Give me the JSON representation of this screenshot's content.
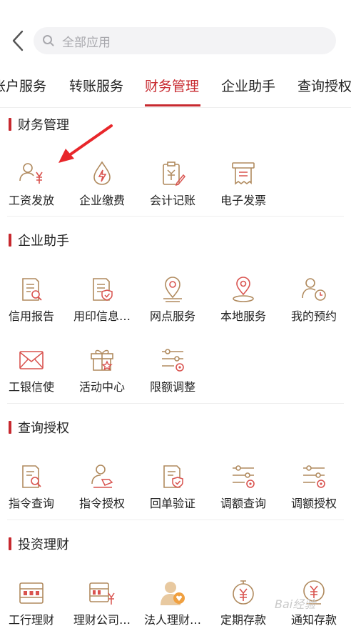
{
  "search": {
    "placeholder": "全部应用"
  },
  "tabs": [
    "账户服务",
    "转账服务",
    "财务管理",
    "企业助手",
    "查询授权"
  ],
  "sections": [
    {
      "title": "财务管理",
      "items": [
        {
          "label": "工资发放",
          "icon": "salary-yuan-icon"
        },
        {
          "label": "企业缴费",
          "icon": "payment-drop-icon"
        },
        {
          "label": "会计记账",
          "icon": "accounting-icon"
        },
        {
          "label": "电子发票",
          "icon": "invoice-icon"
        }
      ]
    },
    {
      "title": "企业助手",
      "items": [
        {
          "label": "信用报告",
          "icon": "credit-report-icon"
        },
        {
          "label": "用印信息…",
          "icon": "seal-info-icon"
        },
        {
          "label": "网点服务",
          "icon": "branch-location-icon"
        },
        {
          "label": "本地服务",
          "icon": "local-service-icon"
        },
        {
          "label": "我的预约",
          "icon": "appointment-icon"
        },
        {
          "label": "工银信使",
          "icon": "mail-icon"
        },
        {
          "label": "活动中心",
          "icon": "gift-icon"
        },
        {
          "label": "限额调整",
          "icon": "limit-adjust-icon"
        }
      ]
    },
    {
      "title": "查询授权",
      "items": [
        {
          "label": "指令查询",
          "icon": "instruction-query-icon"
        },
        {
          "label": "指令授权",
          "icon": "instruction-auth-icon"
        },
        {
          "label": "回单验证",
          "icon": "receipt-verify-icon"
        },
        {
          "label": "调额查询",
          "icon": "adjust-query-icon"
        },
        {
          "label": "调额授权",
          "icon": "adjust-auth-icon"
        }
      ]
    },
    {
      "title": "投资理财",
      "items": [
        {
          "label": "工行理财",
          "icon": "abacus-icon"
        },
        {
          "label": "理财公司…",
          "icon": "abacus-yuan-icon"
        },
        {
          "label": "法人理财…",
          "icon": "corporate-finance-icon"
        },
        {
          "label": "定期存款",
          "icon": "fixed-deposit-icon"
        },
        {
          "label": "通知存款",
          "icon": "notice-deposit-icon"
        }
      ]
    }
  ],
  "watermark": "Bai经验",
  "colors": {
    "accent": "#c7292f",
    "icon_line": "#b08a5e",
    "icon_accent": "#d9534f"
  }
}
